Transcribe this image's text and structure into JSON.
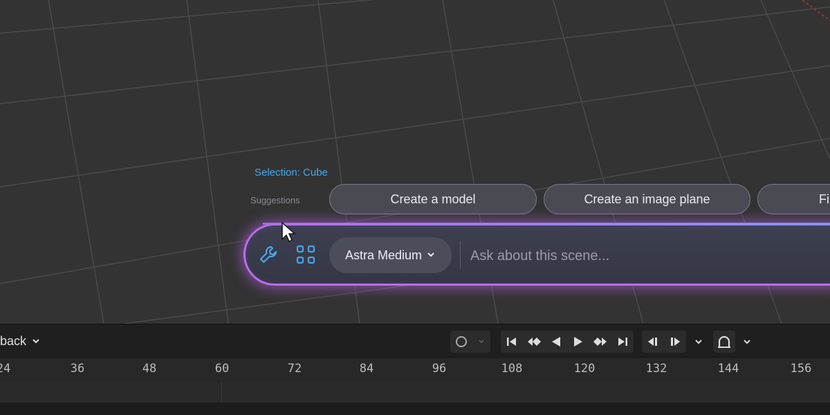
{
  "selection": {
    "label": "Selection: Cube"
  },
  "suggestions": {
    "label": "Suggestions",
    "items": [
      "Create a model",
      "Create an image plane",
      "Fi"
    ]
  },
  "prompt_bar": {
    "model_label": "Astra Medium",
    "placeholder": "Ask about this scene...",
    "tool_icons": [
      "wrench-icon",
      "grid-icon"
    ],
    "accent_color": "#b86ee8"
  },
  "timeline": {
    "playback_label": "back",
    "ticks": [
      "24",
      "36",
      "48",
      "60",
      "72",
      "84",
      "96",
      "108",
      "120",
      "132",
      "144",
      "156"
    ],
    "controls": [
      "record-icon",
      "jump-start-icon",
      "prev-keyframe-icon",
      "play-reverse-icon",
      "play-icon",
      "next-keyframe-icon",
      "jump-end-icon",
      "prev-marker-icon",
      "next-marker-icon",
      "snap-icon"
    ]
  }
}
